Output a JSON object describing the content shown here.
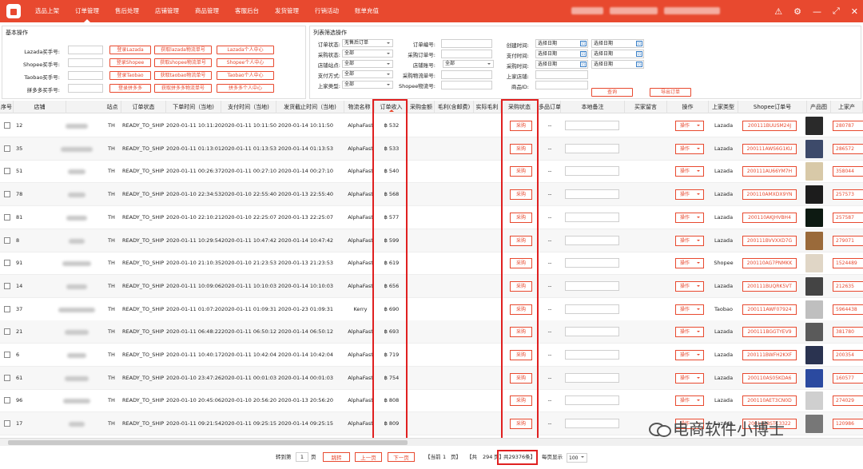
{
  "nav": [
    "选品上架",
    "订单管理",
    "售后处理",
    "店铺管理",
    "商品管理",
    "客服后台",
    "发货管理",
    "行销活动",
    "账单充值"
  ],
  "active_nav": 1,
  "basic": {
    "title": "基本操作",
    "rows": [
      {
        "label": "Lazada买手号:",
        "btn1": "登录Lazada",
        "btn2": "获取lazada物流单号",
        "btn3": "Lazada个人中心"
      },
      {
        "label": "Shopee买手号:",
        "btn1": "登录Shopee",
        "btn2": "获取shopee物流单号",
        "btn3": "Shopee个人中心"
      },
      {
        "label": "Taobao买手号:",
        "btn1": "登录Taobao",
        "btn2": "获取taobao物流单号",
        "btn3": "Taobao个人中心"
      },
      {
        "label": "拼多多买手号:",
        "btn1": "登录拼多多",
        "btn2": "获取拼多多物流单号",
        "btn3": "拼多多个人中心"
      }
    ]
  },
  "filter": {
    "title": "列表筛选操作",
    "c1": [
      {
        "label": "订单状态:",
        "value": "无售后订单"
      },
      {
        "label": "采购状态:",
        "value": "全部"
      },
      {
        "label": "店铺站点:",
        "value": "全部"
      },
      {
        "label": "支付方式:",
        "value": "全部"
      },
      {
        "label": "上家类型:",
        "value": "全部"
      }
    ],
    "c2": [
      {
        "label": "订单编号:"
      },
      {
        "label": "采购订单号:"
      },
      {
        "label": "店铺账号:",
        "value": "全部"
      },
      {
        "label": "采购物流单号:"
      },
      {
        "label": "Shopee物流号:"
      }
    ],
    "c3": [
      {
        "label": "创建时间:",
        "from": "选择日期",
        "to": "选择日期"
      },
      {
        "label": "支付时间:",
        "from": "选择日期",
        "to": "选择日期"
      },
      {
        "label": "采购时间:",
        "from": "选择日期",
        "to": "选择日期"
      },
      {
        "label": "上家店铺:"
      },
      {
        "label": "商品ID:"
      }
    ],
    "search": "查询",
    "export": "导出订单"
  },
  "columns": [
    "序号",
    "店铺",
    "站点",
    "订单状态",
    "下单时间（当地)",
    "支付时间（当地)",
    "发货截止时间（当地)",
    "物流名称",
    "订单收入",
    "采购金额",
    "毛利(含邮费)",
    "实际毛利",
    "采购状态",
    "多品订单",
    "本地备注",
    "买家留言",
    "操作",
    "上家类型",
    "Shopee订单号",
    "产品图",
    "上家产"
  ],
  "rows": [
    {
      "no": "12",
      "site": "TH",
      "status": "READY_TO_SHIP",
      "order": "2020-01-11 10:11:20",
      "pay": "2020-01-11 10:11:50",
      "ship": "2020-01-14 10:11:50",
      "log": "AlphaFast",
      "inc": "฿ 532",
      "ps": "采购",
      "multi": "--",
      "op": "操作",
      "up": "Lazada",
      "sn": "200111BUUSM24J",
      "pid": "280787",
      "img": "#2a2a2a"
    },
    {
      "no": "35",
      "site": "TH",
      "status": "READY_TO_SHIP",
      "order": "2020-01-11 01:13:01",
      "pay": "2020-01-11 01:13:53",
      "ship": "2020-01-14 01:13:53",
      "log": "AlphaFast",
      "inc": "฿ 533",
      "ps": "采购",
      "multi": "--",
      "op": "操作",
      "up": "Lazada",
      "sn": "200111AWS6G1KU",
      "pid": "286572",
      "img": "#3d4a6a"
    },
    {
      "no": "51",
      "site": "TH",
      "status": "READY_TO_SHIP",
      "order": "2020-01-11 00:26:37",
      "pay": "2020-01-11 00:27:10",
      "ship": "2020-01-14 00:27:10",
      "log": "AlphaFast",
      "inc": "฿ 540",
      "ps": "采购",
      "multi": "--",
      "op": "操作",
      "up": "Lazada",
      "sn": "200111AU66YM7H",
      "pid": "358044",
      "img": "#d8c9a8"
    },
    {
      "no": "78",
      "site": "TH",
      "status": "READY_TO_SHIP",
      "order": "2020-01-10 22:34:53",
      "pay": "2020-01-10 22:55:40",
      "ship": "2020-01-13 22:55:40",
      "log": "AlphaFast",
      "inc": "฿ 568",
      "ps": "采购",
      "multi": "--",
      "op": "操作",
      "up": "Lazada",
      "sn": "200110AMXDX9YN",
      "pid": "257573",
      "img": "#1c1c1c"
    },
    {
      "no": "81",
      "site": "TH",
      "status": "READY_TO_SHIP",
      "order": "2020-01-10 22:10:21",
      "pay": "2020-01-10 22:25:07",
      "ship": "2020-01-13 22:25:07",
      "log": "AlphaFast",
      "inc": "฿ 577",
      "ps": "采购",
      "multi": "--",
      "op": "操作",
      "up": "Lazada",
      "sn": "200110AKJHVBH4",
      "pid": "257587",
      "img": "#0d1a12"
    },
    {
      "no": "8",
      "site": "TH",
      "status": "READY_TO_SHIP",
      "order": "2020-01-11 10:29:54",
      "pay": "2020-01-11 10:47:42",
      "ship": "2020-01-14 10:47:42",
      "log": "AlphaFast",
      "inc": "฿ 599",
      "ps": "采购",
      "multi": "--",
      "op": "操作",
      "up": "Lazada",
      "sn": "200111BVVXXD7G",
      "pid": "279071",
      "img": "#9a6a3a"
    },
    {
      "no": "91",
      "site": "TH",
      "status": "READY_TO_SHIP",
      "order": "2020-01-10 21:10:35",
      "pay": "2020-01-10 21:23:53",
      "ship": "2020-01-13 21:23:53",
      "log": "AlphaFast",
      "inc": "฿ 619",
      "ps": "采购",
      "multi": "--",
      "op": "操作",
      "up": "Shopee",
      "sn": "200110AG7PNMKK",
      "pid": "1524489",
      "img": "#e0d6c6"
    },
    {
      "no": "14",
      "site": "TH",
      "status": "READY_TO_SHIP",
      "order": "2020-01-11 10:09:06",
      "pay": "2020-01-11 10:10:03",
      "ship": "2020-01-14 10:10:03",
      "log": "AlphaFast",
      "inc": "฿ 656",
      "ps": "采购",
      "multi": "--",
      "op": "操作",
      "up": "Lazada",
      "sn": "200111BUQRK5VT",
      "pid": "212635",
      "img": "#444"
    },
    {
      "no": "37",
      "site": "TH",
      "status": "READY_TO_SHIP",
      "order": "2020-01-11 01:07:20",
      "pay": "2020-01-11 01:09:31",
      "ship": "2020-01-23 01:09:31",
      "log": "Kerry",
      "inc": "฿ 690",
      "ps": "采购",
      "multi": "--",
      "op": "操作",
      "up": "Taobao",
      "sn": "200111AWF07924",
      "pid": "5964438",
      "img": "#bfbfbf"
    },
    {
      "no": "21",
      "site": "TH",
      "status": "READY_TO_SHIP",
      "order": "2020-01-11 06:48:22",
      "pay": "2020-01-11 06:50:12",
      "ship": "2020-01-14 06:50:12",
      "log": "AlphaFast",
      "inc": "฿ 693",
      "ps": "采购",
      "multi": "--",
      "op": "操作",
      "up": "Lazada",
      "sn": "200111BGGTYEV9",
      "pid": "381780",
      "img": "#5a5a5a"
    },
    {
      "no": "6",
      "site": "TH",
      "status": "READY_TO_SHIP",
      "order": "2020-01-11 10:40:17",
      "pay": "2020-01-11 10:42:04",
      "ship": "2020-01-14 10:42:04",
      "log": "AlphaFast",
      "inc": "฿ 719",
      "ps": "采购",
      "multi": "--",
      "op": "操作",
      "up": "Lazada",
      "sn": "200111BWFH2KXF",
      "pid": "200354",
      "img": "#2a3350"
    },
    {
      "no": "61",
      "site": "TH",
      "status": "READY_TO_SHIP",
      "order": "2020-01-10 23:47:26",
      "pay": "2020-01-11 00:01:03",
      "ship": "2020-01-14 00:01:03",
      "log": "AlphaFast",
      "inc": "฿ 754",
      "ps": "采购",
      "multi": "--",
      "op": "操作",
      "up": "Lazada",
      "sn": "200110AS05KDA6",
      "pid": "160577",
      "img": "#2b4aa0"
    },
    {
      "no": "96",
      "site": "TH",
      "status": "READY_TO_SHIP",
      "order": "2020-01-10 20:45:06",
      "pay": "2020-01-10 20:56:20",
      "ship": "2020-01-13 20:56:20",
      "log": "AlphaFast",
      "inc": "฿ 808",
      "ps": "采购",
      "multi": "--",
      "op": "操作",
      "up": "Lazada",
      "sn": "200110AET3CN0D",
      "pid": "274029",
      "img": "#cfcfcf"
    },
    {
      "no": "17",
      "site": "TH",
      "status": "READY_TO_SHIP",
      "order": "2020-01-11 09:21:54",
      "pay": "2020-01-11 09:25:15",
      "ship": "2020-01-14 09:25:15",
      "log": "AlphaFast",
      "inc": "฿ 809",
      "ps": "采购",
      "multi": "--",
      "op": "操作",
      "up": "Lazada",
      "sn": "200111BSTC3322",
      "pid": "120986",
      "img": "#777"
    }
  ],
  "pager": {
    "goto": "转到第",
    "page_input": "1",
    "page_unit": "页",
    "jump": "跳转",
    "prev": "上一页",
    "next": "下一页",
    "current_pre": "【当前",
    "current": "1",
    "current_post": "页】",
    "total_pre": "【共",
    "total_pages": "294",
    "total_post": "页】",
    "total_items": "共29376条】",
    "per_page_label": "每页显示",
    "per_page": "100"
  },
  "watermark": "电商软件小博士"
}
